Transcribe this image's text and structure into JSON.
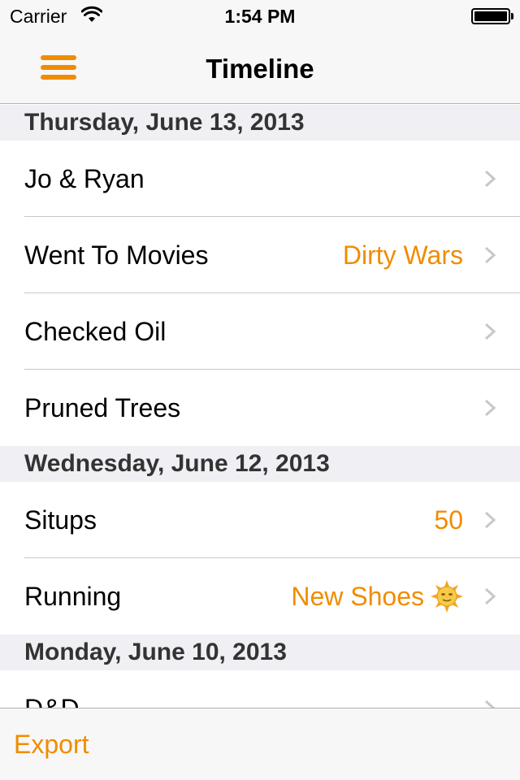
{
  "status_bar": {
    "carrier": "Carrier",
    "time": "1:54 PM",
    "wifi_icon": "wifi-icon",
    "battery_icon": "battery-full-icon"
  },
  "nav_bar": {
    "title": "Timeline",
    "menu_icon": "hamburger-menu-icon"
  },
  "colors": {
    "accent": "#f08c00",
    "section_bg": "#efeff4",
    "bar_bg": "#f7f7f7",
    "separator": "#c8c7cc",
    "chevron": "#c7c7cc"
  },
  "sections": [
    {
      "header": "Thursday, June 13, 2013",
      "rows": [
        {
          "title": "Jo & Ryan",
          "detail": ""
        },
        {
          "title": "Went To Movies",
          "detail": "Dirty Wars"
        },
        {
          "title": "Checked Oil",
          "detail": ""
        },
        {
          "title": "Pruned Trees",
          "detail": ""
        }
      ]
    },
    {
      "header": "Wednesday, June 12, 2013",
      "rows": [
        {
          "title": "Situps",
          "detail": "50"
        },
        {
          "title": "Running",
          "detail": "New Shoes",
          "detail_icon": "sun-face-emoji-icon"
        }
      ]
    },
    {
      "header": "Monday, June 10, 2013",
      "rows": [
        {
          "title": "D&D",
          "detail": ""
        }
      ]
    }
  ],
  "toolbar": {
    "export_label": "Export"
  }
}
